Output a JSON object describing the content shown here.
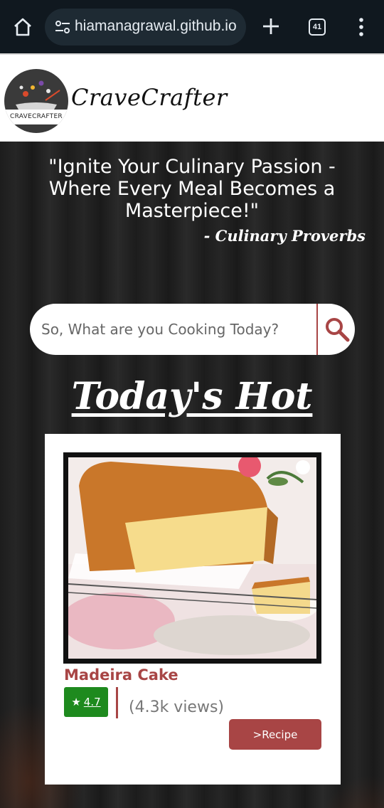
{
  "browser": {
    "url": "hiamanagrawal.github.io",
    "tab_count": "41",
    "icons": [
      "home-icon",
      "site-settings-icon",
      "new-tab-icon",
      "tab-switcher-icon",
      "menu-icon"
    ]
  },
  "header": {
    "logo_text": "CRAVECRAFTER",
    "brand": "CraveCrafter"
  },
  "hero": {
    "quote": "\"Ignite Your Culinary Passion - Where Every Meal Becomes a Masterpiece!\"",
    "proverb": "- Culinary Proverbs"
  },
  "search": {
    "placeholder": "So, What are you Cooking Today?",
    "icon": "search-icon"
  },
  "hot": {
    "title": "Today's Hot",
    "card": {
      "name": "Madeira Cake",
      "rating": "4.7",
      "views": "(4.3k views)",
      "button": ">Recipe"
    }
  },
  "colors": {
    "accent": "#a84545",
    "rating_bg": "#1e8a1e",
    "chrome_bg": "#10181f"
  }
}
